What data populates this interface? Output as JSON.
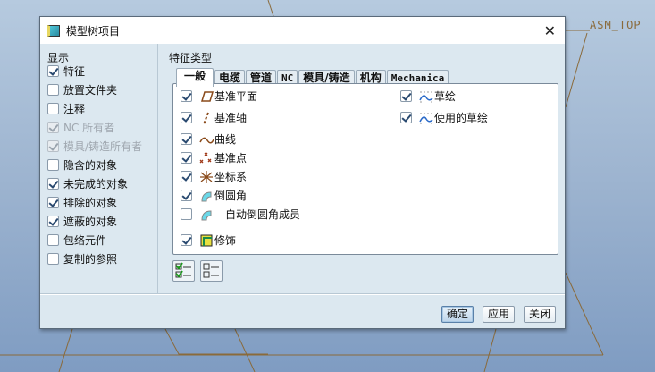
{
  "background": {
    "datum_label": "ASM_TOP"
  },
  "dialog": {
    "title": "模型树项目",
    "close_icon": "close-icon"
  },
  "display": {
    "header": "显示",
    "items": [
      {
        "label": "特征",
        "checked": true,
        "disabled": false
      },
      {
        "label": "放置文件夹",
        "checked": false,
        "disabled": false
      },
      {
        "label": "注释",
        "checked": false,
        "disabled": false
      },
      {
        "label": "NC 所有者",
        "checked": true,
        "disabled": true
      },
      {
        "label": "模具/铸造所有者",
        "checked": true,
        "disabled": true
      },
      {
        "label": "隐含的对象",
        "checked": false,
        "disabled": false
      },
      {
        "label": "未完成的对象",
        "checked": true,
        "disabled": false
      },
      {
        "label": "排除的对象",
        "checked": true,
        "disabled": false
      },
      {
        "label": "遮蔽的对象",
        "checked": true,
        "disabled": false
      },
      {
        "label": "包络元件",
        "checked": false,
        "disabled": false
      },
      {
        "label": "复制的参照",
        "checked": false,
        "disabled": false
      }
    ]
  },
  "feature_types": {
    "header": "特征类型",
    "tabs": [
      "一般",
      "电缆",
      "管道",
      "NC",
      "模具/铸造",
      "机构",
      "Mechanica"
    ],
    "active_tab": "一般",
    "items": [
      {
        "label": "基准平面",
        "checked": true,
        "icon": "datum-plane-icon"
      },
      {
        "label": "基准轴",
        "checked": true,
        "icon": "datum-axis-icon"
      },
      {
        "label": "曲线",
        "checked": true,
        "icon": "curve-icon"
      },
      {
        "label": "基准点",
        "checked": true,
        "icon": "datum-point-icon"
      },
      {
        "label": "坐标系",
        "checked": true,
        "icon": "coordinate-system-icon"
      },
      {
        "label": "倒圆角",
        "checked": true,
        "icon": "round-icon"
      },
      {
        "label": "自动倒圆角成员",
        "checked": false,
        "icon": "auto-round-icon"
      },
      {
        "label": "修饰",
        "checked": true,
        "icon": "cosmetic-icon"
      }
    ],
    "items_right": [
      {
        "label": "草绘",
        "checked": true,
        "icon": "sketch-icon"
      },
      {
        "label": "使用的草绘",
        "checked": true,
        "icon": "used-sketch-icon"
      }
    ],
    "select_all_icon": "select-all-icon",
    "clear_all_icon": "clear-all-icon"
  },
  "buttons": {
    "ok": "确定",
    "apply": "应用",
    "close": "关闭"
  }
}
